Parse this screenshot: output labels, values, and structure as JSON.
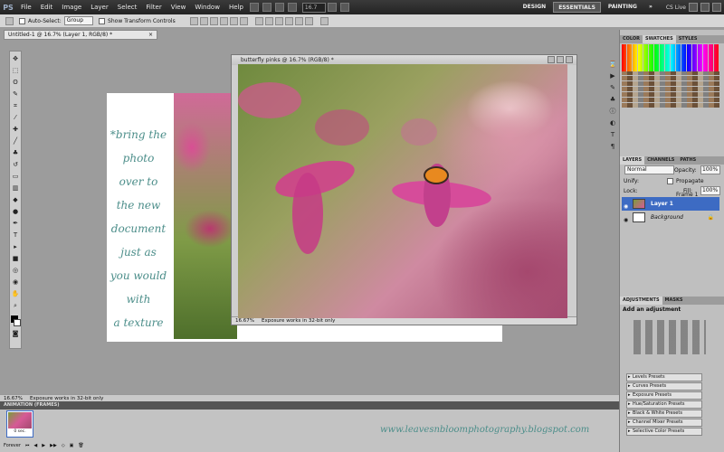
{
  "app": {
    "logo": "PS"
  },
  "menu": [
    "File",
    "Edit",
    "Image",
    "Layer",
    "Select",
    "Filter",
    "View",
    "Window",
    "Help"
  ],
  "zoom_value": "16.7",
  "workspaces": [
    "DESIGN",
    "ESSENTIALS",
    "PAINTING"
  ],
  "active_workspace": "ESSENTIALS",
  "cs_live": "CS Live",
  "options": {
    "auto_select": "Auto-Select:",
    "auto_select_value": "Group",
    "transform_controls": "Show Transform Controls"
  },
  "doc_tab": {
    "title": "Untitled-1 @ 16.7% (Layer 1, RGB/8) *",
    "close": "×"
  },
  "float_doc": {
    "title": "butterfly pinks @ 16.7% (RGB/8) *",
    "zoom": "16.67%",
    "status": "Exposure works in 32-bit only"
  },
  "canvas_text": [
    "*bring the",
    "photo",
    "over to",
    "the new",
    "document",
    "just as",
    "you would",
    "with",
    "a texture"
  ],
  "panels": {
    "color_tabs": [
      "COLOR",
      "SWATCHES",
      "STYLES"
    ],
    "layers_tabs": [
      "LAYERS",
      "CHANNELS",
      "PATHS"
    ],
    "blend_mode": "Normal",
    "opacity_label": "Opacity:",
    "opacity_value": "100%",
    "unify_label": "Unify:",
    "propagate": "Propagate Frame 1",
    "lock_label": "Lock:",
    "fill_label": "Fill:",
    "fill_value": "100%",
    "layers": [
      "Layer 1",
      "Background"
    ],
    "adj_tabs": [
      "ADJUSTMENTS",
      "MASKS"
    ],
    "adj_title": "Add an adjustment",
    "presets": [
      "Levels Presets",
      "Curves Presets",
      "Exposure Presets",
      "Hue/Saturation Presets",
      "Black & White Presets",
      "Channel Mixer Presets",
      "Selective Color Presets"
    ]
  },
  "bottom": {
    "zoom": "16.67%",
    "status": "Exposure works in 32-bit only",
    "anim_tab": "ANIMATION (FRAMES)",
    "frame_time": "0 sec.",
    "loop": "Forever"
  },
  "watermark": "www.leavesnbloomphotography.blogspot.com",
  "colors": {
    "accent": "#3d6bc3",
    "text_teal": "#4c8e8a",
    "workspace_bg": "#9c9c9c"
  }
}
